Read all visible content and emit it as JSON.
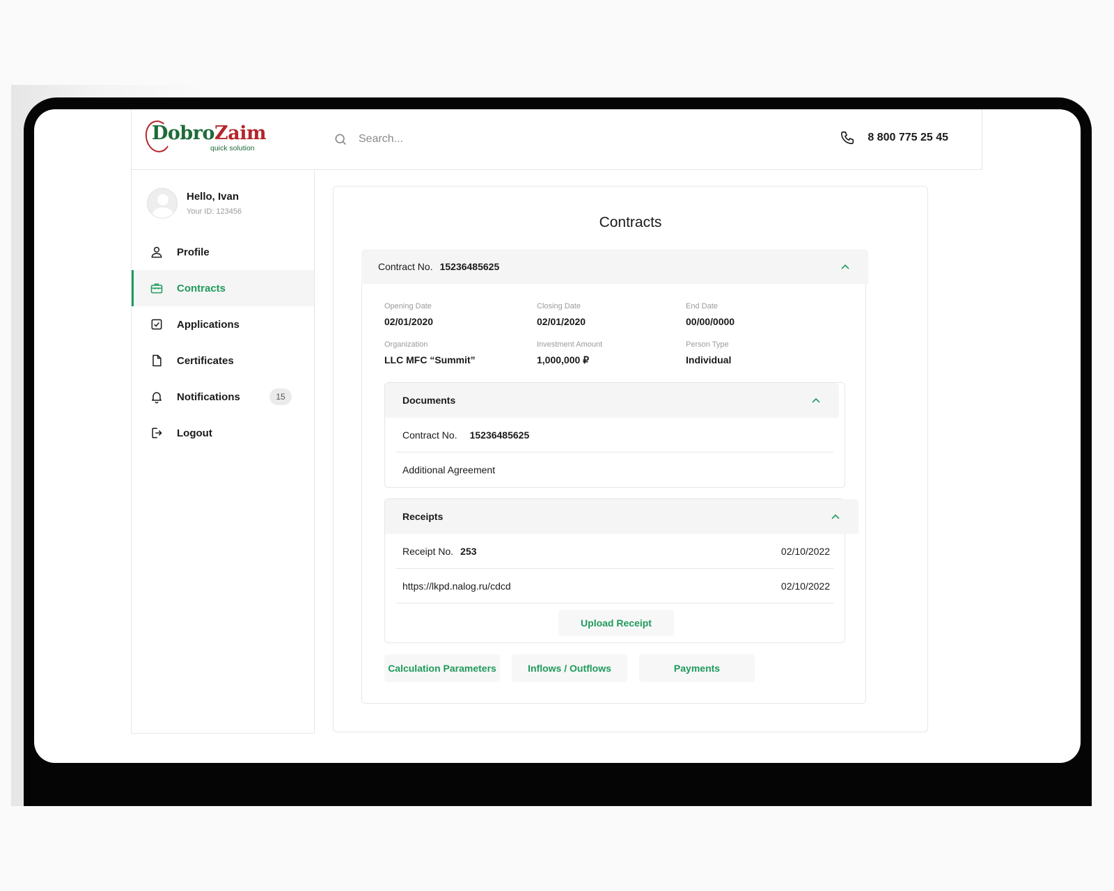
{
  "brand": {
    "name_part1": "Dobro",
    "name_part2": "Zaim",
    "tagline": "quick solution",
    "color_green": "#1e6b38",
    "color_red": "#b3262b"
  },
  "header": {
    "search_placeholder": "Search...",
    "phone": "8 800 775 25 45"
  },
  "user": {
    "greeting": "Hello, Ivan",
    "id_text": "Your ID: 123456"
  },
  "sidebar": {
    "items": [
      {
        "label": "Profile",
        "icon": "user-icon"
      },
      {
        "label": "Contracts",
        "icon": "briefcase-icon",
        "active": true
      },
      {
        "label": "Applications",
        "icon": "checkbox-icon"
      },
      {
        "label": "Certificates",
        "icon": "document-icon"
      },
      {
        "label": "Notifications",
        "icon": "bell-icon",
        "badge": "15"
      },
      {
        "label": "Logout",
        "icon": "logout-icon"
      }
    ],
    "accent": "#1f9a5c"
  },
  "main": {
    "title": "Contracts",
    "contract": {
      "no_label": "Contract No.",
      "no_value": "15236485625",
      "fields": [
        {
          "label": "Opening Date",
          "value": "02/01/2020"
        },
        {
          "label": "Closing Date",
          "value": "02/01/2020"
        },
        {
          "label": "End Date",
          "value": "00/00/0000"
        },
        {
          "label": "Organization",
          "value": "LLC MFC “Summit”"
        },
        {
          "label": "Investment Amount",
          "value": "1,000,000 ₽"
        },
        {
          "label": "Person Type",
          "value": "Individual"
        }
      ],
      "documents": {
        "title": "Documents",
        "rows": [
          {
            "label": "Contract No.",
            "value": "15236485625"
          },
          {
            "label": "Additional Agreement"
          }
        ]
      },
      "receipts": {
        "title": "Receipts",
        "rows": [
          {
            "label": "Receipt No.",
            "value": "253",
            "date": "02/10/2022"
          },
          {
            "label": "https://lkpd.nalog.ru/cdcd",
            "date": "02/10/2022"
          }
        ],
        "upload_label": "Upload Receipt"
      },
      "actions": [
        "Calculation Parameters",
        "Inflows / Outflows",
        "Payments"
      ]
    }
  }
}
